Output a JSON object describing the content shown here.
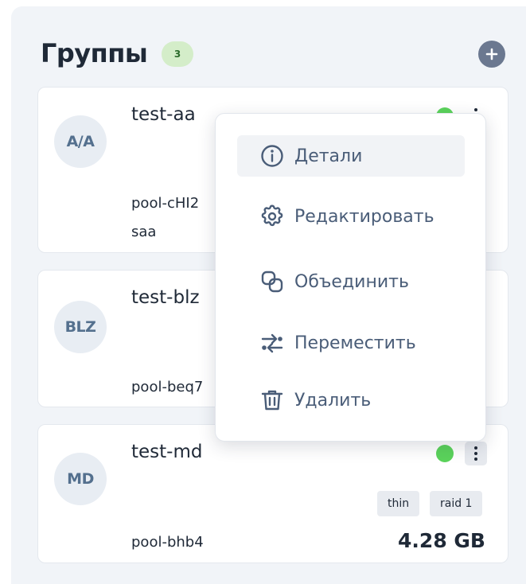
{
  "header": {
    "title": "Группы",
    "count": "3",
    "add_icon": "plus-circle-icon"
  },
  "colors": {
    "panel_bg": "#f1f4f8",
    "status_online": "#5bd35b",
    "count_badge_bg": "#d4edc9",
    "menu_text": "#4a5d78"
  },
  "groups": [
    {
      "initials": "A/A",
      "name": "test-aa",
      "pool_line1": "pool-cHI2",
      "pool_line2": "saa",
      "status": "online",
      "menu_open": true
    },
    {
      "initials": "BLZ",
      "name": "test-blz",
      "pool_line1": "pool-beq7",
      "status": "unknown"
    },
    {
      "initials": "MD",
      "name": "test-md",
      "pool_line1": "pool-bhb4",
      "status": "online",
      "tags": [
        "thin",
        "raid 1"
      ],
      "size": "4.28 GB"
    }
  ],
  "context_menu": {
    "items": [
      {
        "label": "Детали",
        "icon": "info-circle-icon",
        "active": true
      },
      {
        "label": "Редактировать",
        "icon": "gear-icon"
      },
      {
        "label": "Объединить",
        "icon": "merge-icon"
      },
      {
        "label": "Переместить",
        "icon": "move-arrows-icon"
      },
      {
        "label": "Удалить",
        "icon": "trash-icon"
      }
    ]
  }
}
